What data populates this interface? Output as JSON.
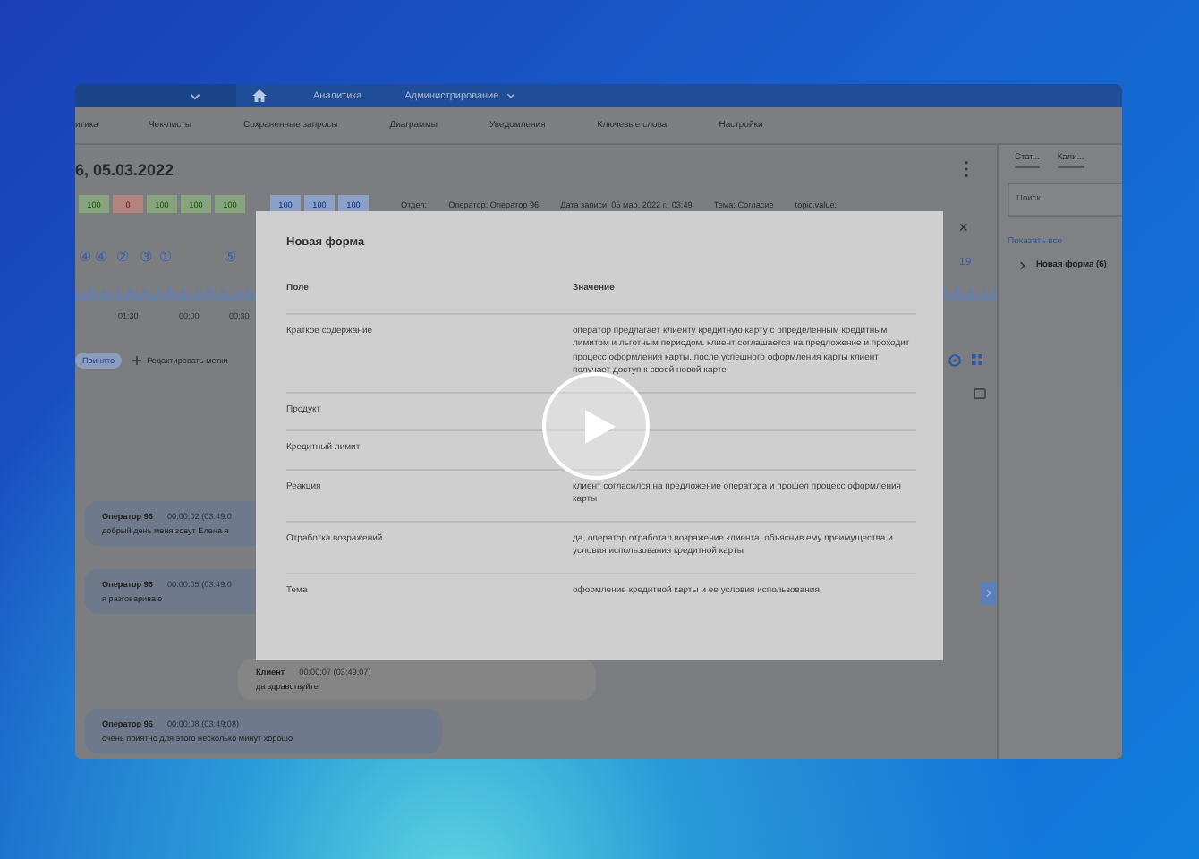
{
  "nav": {
    "items": [
      {
        "label": "Аналитика",
        "dropdown": false
      },
      {
        "label": "Администрирование",
        "dropdown": true
      }
    ]
  },
  "subnav": [
    "итика",
    "Чек-листы",
    "Сохраненные запросы",
    "Диаграммы",
    "Уведомления",
    "Ключевые слова",
    "Настройки"
  ],
  "record": {
    "title": "6, 05.03.2022",
    "scores": [
      {
        "value": "100",
        "color": "#87a47e"
      },
      {
        "value": "0",
        "color": "#b38480"
      },
      {
        "value": "100",
        "color": "#87a47e"
      },
      {
        "value": "100",
        "color": "#87a47e"
      },
      {
        "value": "100",
        "color": "#87a47e"
      },
      {
        "value": "100",
        "color": "#8aa0c8"
      },
      {
        "value": "100",
        "color": "#8aa0c8"
      },
      {
        "value": "100",
        "color": "#8aa0c8"
      }
    ],
    "meta": [
      "Отдел:",
      "Оператор: Оператор 96",
      "Дата записи: 05 мар. 2022 г., 03:49",
      "Тема: Согласие",
      "topic.value:"
    ]
  },
  "close": "×",
  "timeline": {
    "markers": [
      "④",
      "④",
      "②",
      "③",
      "①",
      "⑤"
    ],
    "end_marker": "19",
    "times": [
      "01:30",
      "00:00",
      "00:30"
    ]
  },
  "tags": [
    {
      "label": "Принято"
    }
  ],
  "edit_tags": "Редактировать метки",
  "chat": [
    {
      "kind": "operator",
      "speaker": "Оператор 96",
      "time": "00:00:02 (03:49:0",
      "text": "добрый день меня зовут Елена я"
    },
    {
      "kind": "operator",
      "speaker": "Оператор 96",
      "time": "00:00:05 (03:49:0",
      "text": "я разговариваю"
    },
    {
      "kind": "client",
      "speaker": "Клиент",
      "time": "00:00:07 (03:49:07)",
      "text": "да здравствуйте"
    },
    {
      "kind": "operator",
      "speaker": "Оператор 96",
      "time": "00:00:08 (03:49:08)",
      "text": "очень приятно для этого несколько минут хорошо"
    }
  ],
  "side_panel": {
    "tabs": [
      "Стат...",
      "Кали..."
    ],
    "search": {
      "placeholder": "Поиск"
    },
    "show_all": "Показать все",
    "tree": [
      {
        "label": "Новая форма (6)",
        "expanded": false
      }
    ]
  },
  "modal": {
    "title": "Новая форма",
    "columns": [
      "Поле",
      "Значение"
    ],
    "rows": [
      {
        "field": "Краткое содержание",
        "value": "оператор предлагает клиенту кредитную карту с определенным кредитным лимитом и льготным периодом. клиент соглашается на предложение и проходит процесс оформления карты. после успешного оформления карты клиент получает доступ к своей новой карте"
      },
      {
        "field": "Продукт"
      },
      {
        "field": "Кредитный лимит"
      },
      {
        "field": "Реакция",
        "value": "клиент согласился на предложение оператора и прошел процесс оформления карты"
      },
      {
        "field": "Отработка возражений",
        "value": "да, оператор отработал возражение клиента, объяснив ему преимущества и условия использования кредитной карты"
      },
      {
        "field": "Тема",
        "value": "оформление кредитной карты и ее условия использования"
      }
    ]
  }
}
